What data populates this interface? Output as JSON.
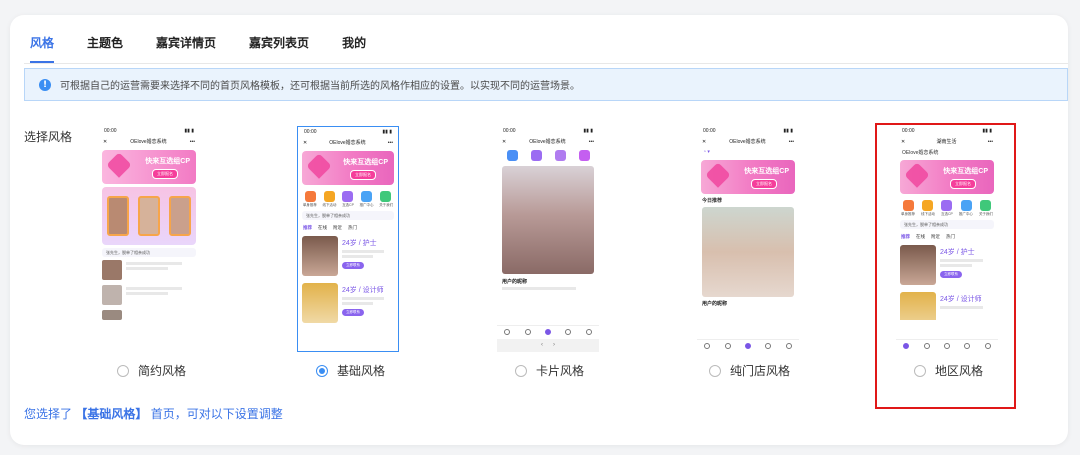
{
  "tabs": [
    {
      "label": "风格",
      "active": true
    },
    {
      "label": "主题色",
      "active": false
    },
    {
      "label": "嘉宾详情页",
      "active": false
    },
    {
      "label": "嘉宾列表页",
      "active": false
    },
    {
      "label": "我的",
      "active": false
    }
  ],
  "notice": {
    "icon": "info-icon",
    "text": "可根据自己的运营需要来选择不同的首页风格模板，还可根据当前所选的风格作相应的设置。以实现不同的运营场景。"
  },
  "select_label": "选择风格",
  "styles": [
    {
      "label": "简约风格",
      "selected": false
    },
    {
      "label": "基础风格",
      "selected": true
    },
    {
      "label": "卡片风格",
      "selected": false
    },
    {
      "label": "纯门店风格",
      "selected": false
    },
    {
      "label": "地区风格",
      "selected": false
    }
  ],
  "preview": {
    "time": "00:00",
    "app_title": "OElove婚恋系统",
    "region_title": "湖南生活",
    "banner_text": "快来互选组CP",
    "banner_button": "立即报名",
    "icons": [
      "单身推荐",
      "线下活动",
      "互选CP",
      "推广中心",
      "关于我们"
    ],
    "notice_text": "张先生，脱单了相亲成功",
    "subtabs": [
      "推荐",
      "在线",
      "附近",
      "热门"
    ],
    "profile1_name": "24岁 / 护士",
    "profile2_name": "24岁 / 设计师",
    "profile_button": "立即联系",
    "card_caption": "用户的昵称",
    "today_label": "今日推荐"
  },
  "summary": {
    "prefix": "您选择了",
    "style": "【基础风格】",
    "suffix": "首页，可对以下设置调整"
  },
  "colors": {
    "accent": "#3a73e6",
    "highlight_box": "#e01818",
    "purple": "#7a56e6"
  }
}
